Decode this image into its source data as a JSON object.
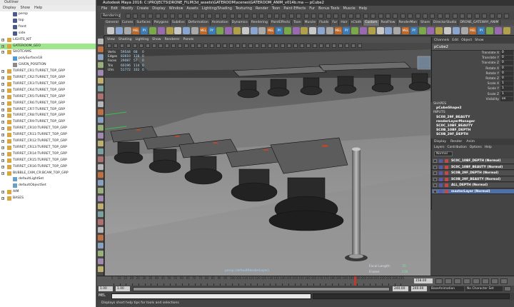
{
  "outliner": {
    "title": "Outliner",
    "menu": [
      "Display",
      "Show",
      "Help"
    ],
    "items": [
      {
        "label": "persp",
        "icon": "camera-icon",
        "indent": false,
        "expand": false,
        "selected": false
      },
      {
        "label": "top",
        "icon": "camera-icon",
        "indent": false,
        "expand": false,
        "selected": false
      },
      {
        "label": "front",
        "icon": "camera-icon",
        "indent": false,
        "expand": false,
        "selected": false
      },
      {
        "label": "side",
        "icon": "camera-icon",
        "indent": false,
        "expand": false,
        "selected": false
      },
      {
        "label": "LIGHTS_KIT",
        "icon": "group-icon",
        "indent": false,
        "expand": true,
        "selected": false
      },
      {
        "label": "GATEROOM_GEO",
        "icon": "group-icon",
        "indent": false,
        "expand": true,
        "selected": true
      },
      {
        "label": "SHOTCAMS",
        "icon": "group-icon",
        "indent": false,
        "expand": true,
        "selected": false
      },
      {
        "label": "polySurface18",
        "icon": "mesh-icon",
        "indent": false,
        "expand": false,
        "selected": false
      },
      {
        "label": "GIVEN_POSITION",
        "icon": "locator-icon",
        "indent": false,
        "expand": false,
        "selected": false
      },
      {
        "label": "TURRET_CR1:TURRET_TOP_GRP",
        "icon": "group-icon",
        "indent": false,
        "expand": true,
        "selected": false
      },
      {
        "label": "TURRET_CR2:TURRET_TOP_GRP",
        "icon": "group-icon",
        "indent": false,
        "expand": true,
        "selected": false
      },
      {
        "label": "TURRET_CR3:TURRET_TOP_GRP",
        "icon": "group-icon",
        "indent": false,
        "expand": true,
        "selected": false
      },
      {
        "label": "TURRET_CR4:TURRET_TOP_GRP",
        "icon": "group-icon",
        "indent": false,
        "expand": true,
        "selected": false
      },
      {
        "label": "TURRET_CR5:TURRET_TOP_GRP",
        "icon": "group-icon",
        "indent": false,
        "expand": true,
        "selected": false
      },
      {
        "label": "TURRET_CR6:TURRET_TOP_GRP",
        "icon": "group-icon",
        "indent": false,
        "expand": true,
        "selected": false
      },
      {
        "label": "TURRET_CR7:TURRET_TOP_GRP",
        "icon": "group-icon",
        "indent": false,
        "expand": true,
        "selected": false
      },
      {
        "label": "TURRET_CR8:TURRET_TOP_GRP",
        "icon": "group-icon",
        "indent": false,
        "expand": true,
        "selected": false
      },
      {
        "label": "TURRET_CR9:TURRET_TOP_GRP",
        "icon": "group-icon",
        "indent": false,
        "expand": true,
        "selected": false
      },
      {
        "label": "TURRET_CR10:TURRET_TOP_GRP",
        "icon": "group-icon",
        "indent": false,
        "expand": true,
        "selected": false
      },
      {
        "label": "TURRET_CR11:TURRET_TOP_GRP",
        "icon": "group-icon",
        "indent": false,
        "expand": true,
        "selected": false
      },
      {
        "label": "TURRET_CR12:TURRET_TOP_GRP",
        "icon": "group-icon",
        "indent": false,
        "expand": true,
        "selected": false
      },
      {
        "label": "TURRET_CR13:TURRET_TOP_GRP",
        "icon": "group-icon",
        "indent": false,
        "expand": true,
        "selected": false
      },
      {
        "label": "TURRET_CR14:TURRET_TOP_GRP",
        "icon": "group-icon",
        "indent": false,
        "expand": true,
        "selected": false
      },
      {
        "label": "TURRET_CR15:TURRET_TOP_GRP",
        "icon": "group-icon",
        "indent": false,
        "expand": true,
        "selected": false
      },
      {
        "label": "TURRET_CR16:TURRET_TOP_GRP",
        "icon": "group-icon",
        "indent": false,
        "expand": true,
        "selected": false
      },
      {
        "label": "BUBBLE_CAM_CR:BCAM_TOP_GRP",
        "icon": "group-icon",
        "indent": false,
        "expand": true,
        "selected": false
      },
      {
        "label": "defaultLightSet",
        "icon": "set-icon",
        "indent": false,
        "expand": false,
        "selected": false
      },
      {
        "label": "defaultObjectSet",
        "icon": "set-icon",
        "indent": false,
        "expand": false,
        "selected": false
      },
      {
        "label": "AIM",
        "icon": "group-icon",
        "indent": false,
        "expand": true,
        "selected": false
      },
      {
        "label": "BASES",
        "icon": "group-icon",
        "indent": false,
        "expand": true,
        "selected": false
      }
    ]
  },
  "window": {
    "title": "Autodesk Maya 2016: C:\\PROJECTS\\DRONE_FILM\\3d_assets\\GATEROOM\\scenes\\GATEROOM_ANIM_v014b.ma  ---  pCube2"
  },
  "main_menu": [
    "File",
    "Edit",
    "Modify",
    "Create",
    "Display",
    "Window",
    "Assets",
    "Lighting/Shading",
    "Texturing",
    "Render",
    "Toon",
    "Paint Effects",
    "Fur",
    "Bonus Tools",
    "Muscle",
    "Help"
  ],
  "status_line": {
    "menu_set": "Rendering"
  },
  "shelf_tabs": [
    "General",
    "Curves",
    "Surfaces",
    "Polygons",
    "Subdivs",
    "Deformation",
    "Animation",
    "Dynamics",
    "Rendering",
    "PaintEffects",
    "Toon",
    "Muscle",
    "Fluids",
    "Fur",
    "Hair",
    "nCloth",
    "Custom",
    "RealFlow",
    "RenderMan",
    "Share",
    "DirectorStudio",
    "DRONE_GATEWAY_ANIM"
  ],
  "active_shelf_tab": "Custom",
  "shelf_icons": [
    {
      "name": "polycube-icon",
      "label": "",
      "color": "#c8c8c8"
    },
    {
      "name": "sphere-icon",
      "label": "",
      "color": "#8aa6d0"
    },
    {
      "name": "cylinder-icon",
      "label": "",
      "color": "#a9a9a9"
    },
    {
      "name": "script-icon",
      "label": "MEL",
      "color": "#c06a2a"
    },
    {
      "name": "script-icon",
      "label": "PY",
      "color": "#3b7db8"
    },
    {
      "name": "merge-icon",
      "label": "",
      "color": "#7aa84a"
    },
    {
      "name": "extrude-icon",
      "label": "",
      "color": "#9a6ab0"
    },
    {
      "name": "bevel-icon",
      "label": "",
      "color": "#b0a04a"
    }
  ],
  "viewport": {
    "menu": [
      "View",
      "Shading",
      "Lighting",
      "Show",
      "Renderer",
      "Panels"
    ],
    "hud": [
      {
        "label": "Verts",
        "value": "59544",
        "b": "68",
        "c": "0"
      },
      {
        "label": "Edges",
        "value": "83610",
        "b": "116",
        "c": "0"
      },
      {
        "label": "Faces",
        "value": "29087",
        "b": "57",
        "c": "0"
      },
      {
        "label": "Tris",
        "value": "60196",
        "b": "114",
        "c": "0"
      },
      {
        "label": "UVs",
        "value": "51772",
        "b": "102",
        "c": "0"
      }
    ],
    "camera": "persp (defaultRenderLayer)",
    "focal_length_label": "Focal Length:",
    "focal_length_value": "35",
    "frame_label": "Frame:",
    "frame_value": "158"
  },
  "channel_box": {
    "tabs": [
      "Channels",
      "Edit",
      "Object",
      "Show"
    ],
    "object": "pCube2",
    "attributes": [
      {
        "name": "Translate X",
        "value": "0"
      },
      {
        "name": "Translate Y",
        "value": "0"
      },
      {
        "name": "Translate Z",
        "value": "0"
      },
      {
        "name": "Rotate X",
        "value": "0"
      },
      {
        "name": "Rotate Y",
        "value": "0"
      },
      {
        "name": "Rotate Z",
        "value": "0"
      },
      {
        "name": "Scale X",
        "value": "1"
      },
      {
        "name": "Scale Y",
        "value": "1"
      },
      {
        "name": "Scale Z",
        "value": "1"
      },
      {
        "name": "Visibility",
        "value": "on"
      }
    ],
    "shapes_header": "SHAPES",
    "shape": "pCubeShape2",
    "inputs_header": "INPUTS",
    "inputs": [
      "SC08_29F_BEAUTY",
      "renderLayerManager",
      "SC0C_10BF_BEAUTY",
      "SC0B_10BF_DEPTH",
      "SC0B_29F_DEPTH"
    ]
  },
  "layers": {
    "tabs": [
      "Display",
      "Render",
      "Anim"
    ],
    "menu": [
      "Layers",
      "Contribution",
      "Options",
      "Help"
    ],
    "filter": "Normal",
    "rows": [
      {
        "name": "SC0C_10BF_DEPTH (Normal)",
        "active": false
      },
      {
        "name": "SC0C_10BF_BEAUTY (Normal)",
        "active": false
      },
      {
        "name": "SC0B_29F_DEPTH (Normal)",
        "active": false
      },
      {
        "name": "SC0B_29F_BEAUTY (Normal)",
        "active": false
      },
      {
        "name": "ALL_DEPTH (Normal)",
        "active": false
      },
      {
        "name": "masterLayer (Normal)",
        "active": true
      }
    ]
  },
  "timeline": {
    "ticks": [
      "5",
      "10",
      "15",
      "20",
      "25",
      "30",
      "35",
      "40",
      "45",
      "50",
      "55",
      "60",
      "65",
      "70",
      "75",
      "80",
      "85",
      "90",
      "95",
      "100",
      "105",
      "110",
      "115",
      "120",
      "125",
      "130",
      "135",
      "140",
      "145",
      "150",
      "155",
      "160",
      "165",
      "170",
      "175",
      "180",
      "185",
      "190",
      "195",
      "200",
      "205",
      "210",
      "215",
      "220",
      "225",
      "230",
      "235"
    ],
    "current_frame": "158.00",
    "range_start": "1.00",
    "range_inner_start": "1.00",
    "range_inner_end": "240.00",
    "range_end": "240.00",
    "anim_layer": "BaseAnimation",
    "character_set": "No Character Set"
  },
  "command_line": {
    "label": "MEL"
  },
  "help_line": "Displays short help tips for tools and selections",
  "colors": {
    "selection": "#9fe68c",
    "active_layer": "#4f6fa8",
    "viewport_bg": "#6a6a6a"
  }
}
